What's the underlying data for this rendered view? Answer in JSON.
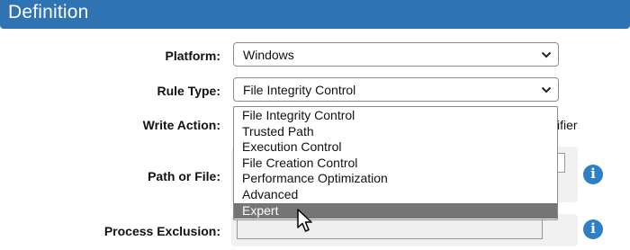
{
  "header": {
    "title": "Definition"
  },
  "form": {
    "platform": {
      "label": "Platform:",
      "value": "Windows"
    },
    "rule_type": {
      "label": "Rule Type:",
      "value": "File Integrity Control"
    },
    "write_action": {
      "label": "Write Action:",
      "partial_text": "ifier"
    },
    "path_or_file": {
      "label": "Path or File:"
    },
    "process_exclusion": {
      "label": "Process Exclusion:"
    }
  },
  "dropdown": {
    "options": [
      "File Integrity Control",
      "Trusted Path",
      "Execution Control",
      "File Creation Control",
      "Performance Optimization",
      "Advanced",
      "Expert"
    ],
    "highlighted": "Expert"
  },
  "colors": {
    "header_bg": "#2f73b3",
    "info_icon": "#2f7fc6",
    "highlight_bg": "#757575"
  },
  "icons": {
    "info": "i",
    "chevron": "chevron-down-icon",
    "cursor": "mouse-pointer-icon"
  }
}
